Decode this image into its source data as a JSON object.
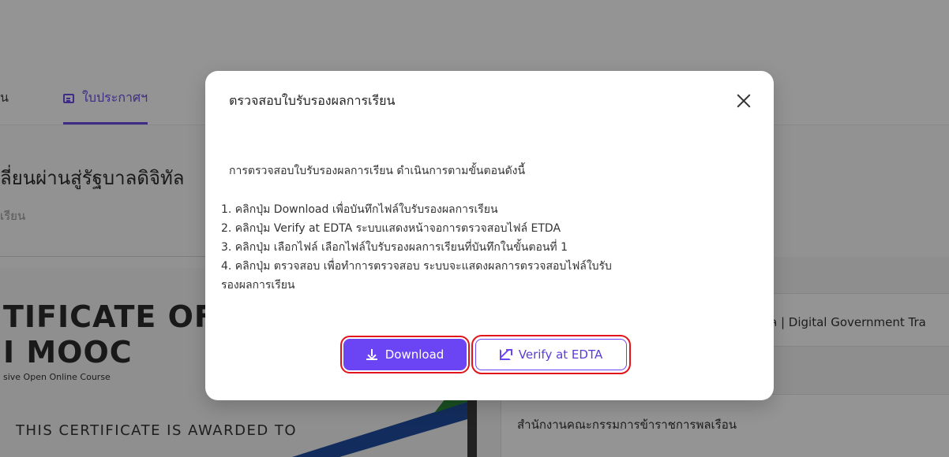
{
  "background": {
    "tabs": {
      "left_partial_label": "น",
      "certificate_label": "ใบประกาศฯ"
    },
    "course_title": "ลี่ยนผ่านสู่รัฐบาลดิจิทัล",
    "course_subtitle": "เรียน",
    "certificate_preview": {
      "heading_line1": "TIFICATE OF C",
      "heading_line2": "I MOOC",
      "tagline": "sive Open Online Course",
      "awarded_text": "THIS CERTIFICATE IS AWARDED TO"
    },
    "side_panel": {
      "card1_text": "ล | Digital Government Tra",
      "card2_text": "สำนักงานคณะกรรมการข้าราชการพลเรือน"
    }
  },
  "modal": {
    "title": "ตรวจสอบใบรับรองผลการเรียน",
    "intro": "การตรวจสอบใบรับรองผลการเรียน ดำเนินการตามขั้นตอนดังนี้",
    "steps": [
      "1. คลิกปุ่ม Download เพื่อบันทึกไฟล์ใบรับรองผลการเรียน",
      "2. คลิกปุ่ม Verify at EDTA ระบบแสดงหน้าจอการตรวจสอบไฟล์ ETDA",
      "3. คลิกปุ่ม เลือกไฟล์ เลือกไฟล์ใบรับรองผลการเรียนที่บันทึกในขั้นตอนที่ 1",
      "4. คลิกปุ่ม ตรวจสอบ เพื่อทำการตรวจสอบ ระบบจะแสดงผลการตรวจสอบไฟล์ใบรับ",
      "รองผลการเรียน"
    ],
    "download_label": "Download",
    "verify_label": "Verify at EDTA"
  },
  "colors": {
    "accent": "#6b44f4",
    "highlight_box": "#e0141a"
  },
  "icons": {
    "tab_certificate": "certificate-icon",
    "close": "close-icon",
    "download": "download-icon",
    "verify": "external-link-icon"
  }
}
